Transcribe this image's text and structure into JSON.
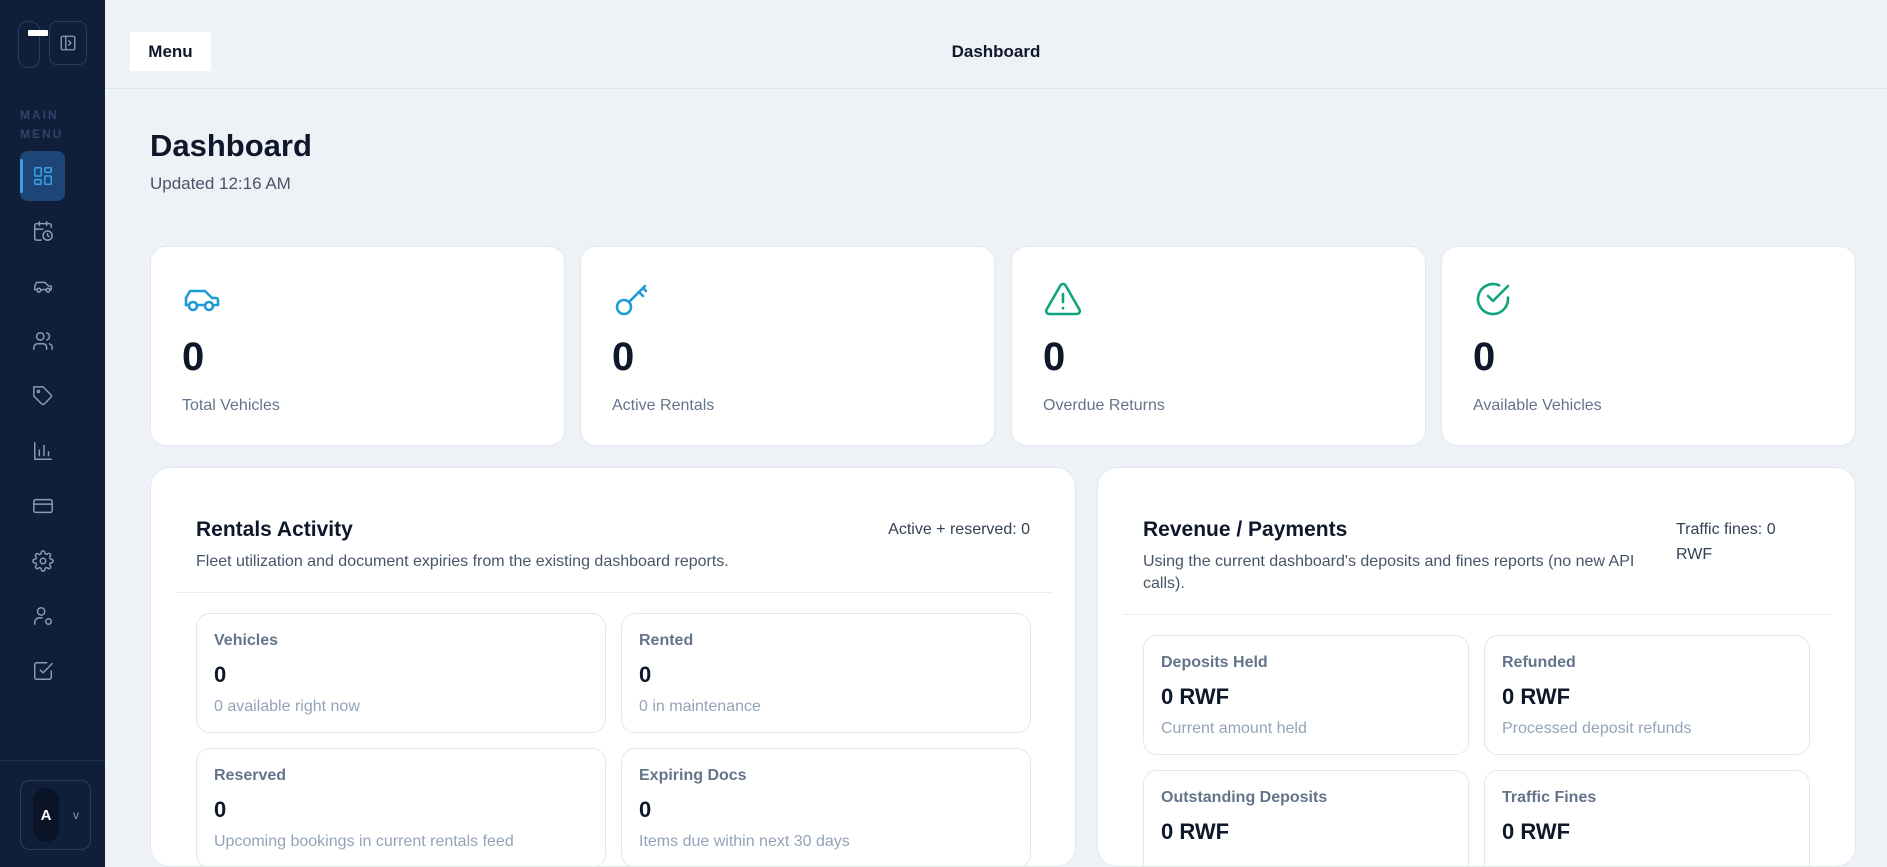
{
  "sidebar": {
    "menu_label": "MAIN MENU",
    "nav_icons": [
      "dashboard-icon",
      "calendar-clock-icon",
      "car-icon",
      "users-icon",
      "tag-icon",
      "bar-chart-icon",
      "credit-card-icon",
      "settings-icon",
      "user-settings-icon",
      "checkbox-icon"
    ],
    "user": {
      "initial": "A",
      "chevron": "v"
    }
  },
  "topbar": {
    "menu_label": "Menu",
    "title": "Dashboard"
  },
  "page": {
    "title": "Dashboard",
    "updated": "Updated 12:16 AM"
  },
  "stats": [
    {
      "icon": "car-icon",
      "value": "0",
      "label": "Total Vehicles",
      "color": "#1f9bd7"
    },
    {
      "icon": "key-icon",
      "value": "0",
      "label": "Active Rentals",
      "color": "#1f9bd7"
    },
    {
      "icon": "warning-icon",
      "value": "0",
      "label": "Overdue Returns",
      "color": "#10a37f"
    },
    {
      "icon": "check-circle-icon",
      "value": "0",
      "label": "Available Vehicles",
      "color": "#10a37f"
    }
  ],
  "rentals": {
    "title": "Rentals Activity",
    "subtitle": "Fleet utilization and document expiries from the existing dashboard reports.",
    "meta": "Active + reserved: 0",
    "cards": [
      {
        "label": "Vehicles",
        "value": "0",
        "sub": "0 available right now"
      },
      {
        "label": "Rented",
        "value": "0",
        "sub": "0 in maintenance"
      },
      {
        "label": "Reserved",
        "value": "0",
        "sub": "Upcoming bookings in current rentals feed"
      },
      {
        "label": "Expiring Docs",
        "value": "0",
        "sub": "Items due within next 30 days"
      }
    ]
  },
  "revenue": {
    "title": "Revenue / Payments",
    "subtitle": "Using the current dashboard's deposits and fines reports (no new API calls).",
    "meta": "Traffic fines: 0 RWF",
    "cards": [
      {
        "label": "Deposits Held",
        "value": "0 RWF",
        "sub": "Current amount held"
      },
      {
        "label": "Refunded",
        "value": "0 RWF",
        "sub": "Processed deposit refunds"
      },
      {
        "label": "Outstanding Deposits",
        "value": "0 RWF",
        "sub": ""
      },
      {
        "label": "Traffic Fines",
        "value": "0 RWF",
        "sub": ""
      }
    ]
  }
}
